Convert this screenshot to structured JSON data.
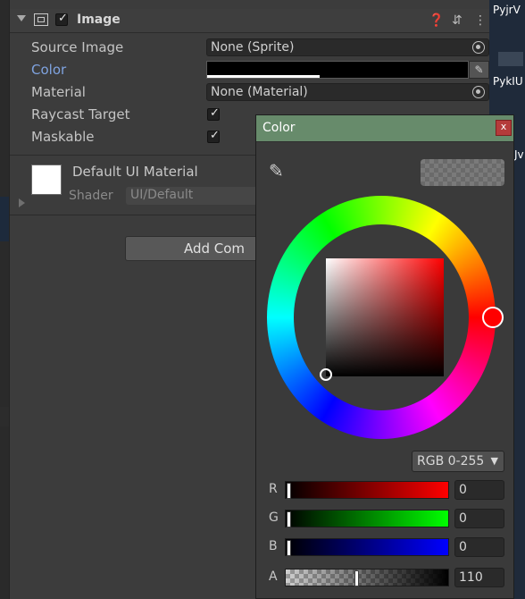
{
  "component": {
    "title": "Image",
    "enabled": true
  },
  "properties": {
    "source_image_label": "Source Image",
    "source_image_value": "None (Sprite)",
    "color_label": "Color",
    "material_label": "Material",
    "material_value": "None (Material)",
    "raycast_label": "Raycast Target",
    "raycast_checked": true,
    "maskable_label": "Maskable",
    "maskable_checked": true
  },
  "material_preview": {
    "name": "Default UI Material",
    "shader_label": "Shader",
    "shader_value": "UI/Default"
  },
  "add_component_label": "Add Com",
  "scene_texts": [
    "PyjrV",
    "PykIU",
    "Jv"
  ],
  "color_picker": {
    "title": "Color",
    "close_label": "x",
    "mode": "RGB 0-255",
    "channels": [
      {
        "label": "R",
        "value": "0",
        "fraction": 0,
        "gradient_from": "#000000",
        "gradient_to": "#ff0000"
      },
      {
        "label": "G",
        "value": "0",
        "fraction": 0,
        "gradient_from": "#000000",
        "gradient_to": "#00ff00"
      },
      {
        "label": "B",
        "value": "0",
        "fraction": 0,
        "gradient_from": "#000000",
        "gradient_to": "#0000ff"
      },
      {
        "label": "A",
        "value": "110",
        "fraction": 0.431
      }
    ],
    "hue_color": "#ff0000",
    "current_color": "#000000"
  },
  "colors": {
    "header_green": "#678b6b",
    "label_blue": "#7fa3e0"
  }
}
